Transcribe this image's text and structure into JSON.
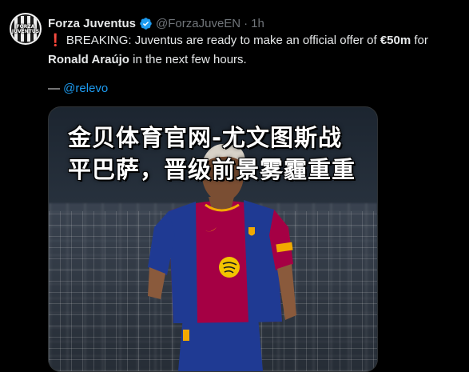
{
  "tweet": {
    "display_name": "Forza Juventus",
    "handle": "@ForzaJuveEN",
    "separator": "·",
    "time": "1h",
    "avatar_text_line1": "FORZA",
    "avatar_text_line2": "JUVENTUS",
    "icons": {
      "verified": "verified-badge-icon",
      "alert": "red-exclamation-icon"
    },
    "alert_glyph": "❗",
    "text_part1": "BREAKING: Juventus are ready to make an official offer of ",
    "text_amount": "€50m",
    "text_part2": " for",
    "text_player": "Ronald Araújo",
    "text_part3": " in the next few hours.",
    "source_prefix": "— ",
    "source_mention": "@relevo"
  },
  "media": {
    "overlay_line1": "金贝体育官网-尤文图斯战",
    "overlay_line2": "平巴萨，晋级前景雾霾重重"
  },
  "colors": {
    "background": "#000000",
    "link": "#1d9bf0",
    "verified": "#1d9bf0",
    "muted": "#71767b",
    "barca_blue": "#1f3a93",
    "barca_red": "#a50044"
  }
}
